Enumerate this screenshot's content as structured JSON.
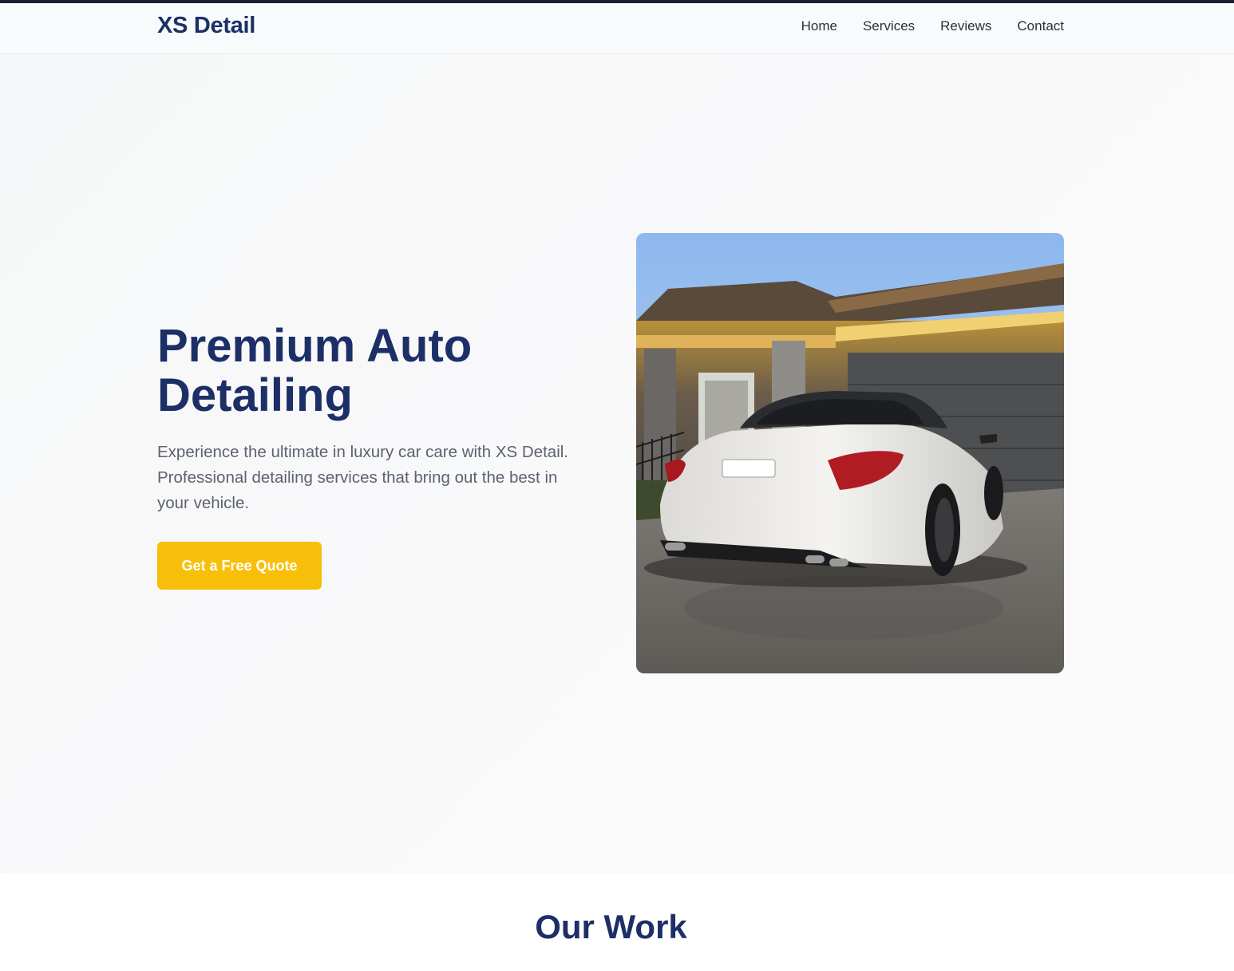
{
  "brand": {
    "name": "XS Detail"
  },
  "nav": {
    "links": [
      {
        "label": "Home"
      },
      {
        "label": "Services"
      },
      {
        "label": "Reviews"
      },
      {
        "label": "Contact"
      }
    ]
  },
  "hero": {
    "title": "Premium Auto Detailing",
    "subtitle": "Experience the ultimate in luxury car care with XS Detail. Professional detailing services that bring out the best in your vehicle.",
    "cta_label": "Get a Free Quote",
    "image": {
      "subject": "white sedan parked in driveway in front of house"
    }
  },
  "work": {
    "title": "Our Work"
  },
  "colors": {
    "brand_navy": "#1c2f66",
    "accent_yellow": "#f8bf0a",
    "text_gray": "#5b6270",
    "top_bar": "#1b2133"
  }
}
